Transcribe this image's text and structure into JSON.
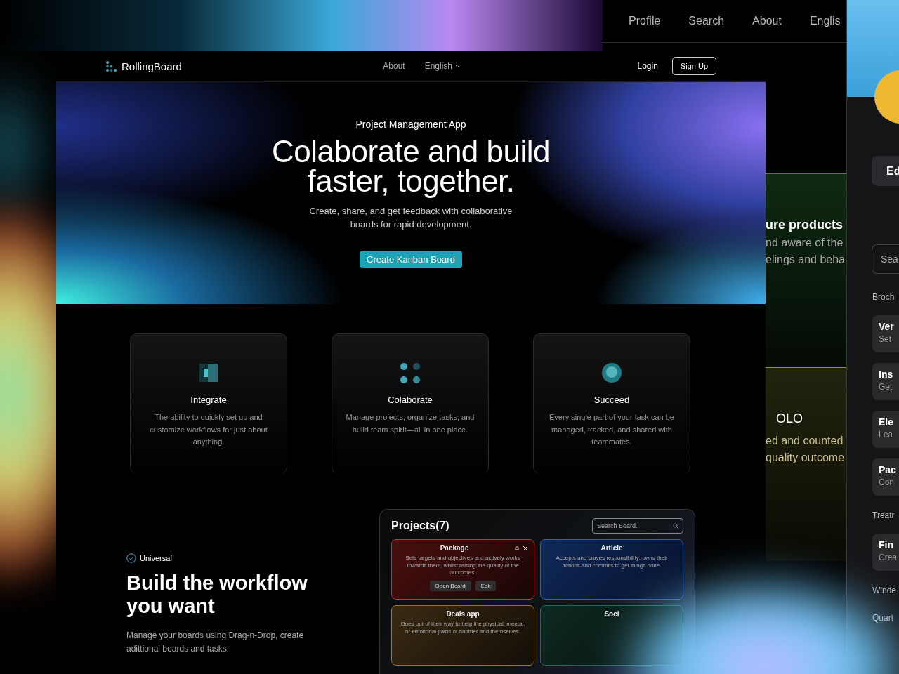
{
  "back_window": {
    "nav": [
      "Profile",
      "Search",
      "About",
      "Englis"
    ],
    "sections": [
      {
        "kind": "green",
        "title": "ure products",
        "lines": [
          "nd aware of the",
          "elings and beha"
        ]
      },
      {
        "kind": "olive",
        "title": "OLO",
        "lines": [
          "ed and counted",
          "quality outcome"
        ]
      }
    ]
  },
  "side_panel": {
    "edit_button": "Ed",
    "search": {
      "placeholder": "Sea"
    },
    "entries": [
      {
        "kind": "heading",
        "text": "Broch"
      },
      {
        "kind": "item",
        "title": "Ver",
        "subtitle": "Set"
      },
      {
        "kind": "item",
        "title": "Ins",
        "subtitle": "Get"
      },
      {
        "kind": "item",
        "title": "Ele",
        "subtitle": "Lea"
      },
      {
        "kind": "item",
        "title": "Pac",
        "subtitle": "Con"
      },
      {
        "kind": "heading",
        "text": "Treatr"
      },
      {
        "kind": "item",
        "title": "Fin",
        "subtitle": "Crea"
      },
      {
        "kind": "heading",
        "text": "Winde"
      },
      {
        "kind": "heading",
        "text": "Quart"
      }
    ]
  },
  "main": {
    "brand": "RollingBoard",
    "nav": [
      {
        "label": "About",
        "dropdown": false
      },
      {
        "label": "English",
        "dropdown": true
      }
    ],
    "login": "Login",
    "signup": "Sign Up",
    "hero": {
      "eyebrow": "Project Management App",
      "title": "Colaborate and build faster, together.",
      "subtitle": "Create, share, and get feedback with collaborative boards for rapid development.",
      "cta": "Create Kanban Board"
    },
    "features": [
      {
        "kind": "integrate",
        "title": "Integrate",
        "text": "The ability to quickly set up and customize workflows for just about anything."
      },
      {
        "kind": "collaborate",
        "title": "Colaborate",
        "text": "Manage projects, organize tasks, and build team spirit—all in one place."
      },
      {
        "kind": "succeed",
        "title": "Succeed",
        "text": "Every single part of your task can be managed, tracked, and shared with teammates."
      }
    ],
    "workflow": {
      "badge": "Universal",
      "title": "Build the workflow you want",
      "text": "Manage your boards using Drag-n-Drop, create adittional boards and tasks."
    },
    "preview": {
      "title": "Projects(7)",
      "search_placeholder": "Search Board..",
      "cards": [
        {
          "kind": "package",
          "title": "Package",
          "text": "Sets targets and objectives and actively works towards them, whilst raising the quality of the outcomes.",
          "buttons": [
            "Open Board",
            "Edit"
          ]
        },
        {
          "kind": "article",
          "title": "Article",
          "text": "Accepts and craves responsibility; owns their actions and commits to get things done."
        },
        {
          "kind": "deals",
          "title": "Deals app",
          "text": "Goes out of their way to help the physical, mental, or emotional pains of another and themselves."
        },
        {
          "kind": "social",
          "title": "Soci"
        }
      ]
    }
  }
}
